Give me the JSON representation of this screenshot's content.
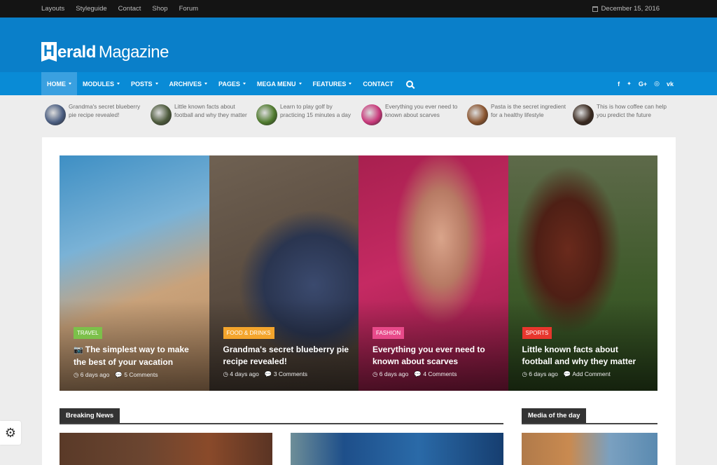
{
  "topbar": {
    "links": [
      "Layouts",
      "Styleguide",
      "Contact",
      "Shop",
      "Forum"
    ],
    "date_icon": "calendar-icon",
    "date": "December 15, 2016"
  },
  "logo": {
    "letter": "H",
    "bold": "erald",
    "light": "Magazine"
  },
  "nav": {
    "items": [
      {
        "label": "HOME",
        "caret": true,
        "active": true
      },
      {
        "label": "MODULES",
        "caret": true
      },
      {
        "label": "POSTS",
        "caret": true
      },
      {
        "label": "ARCHIVES",
        "caret": true
      },
      {
        "label": "PAGES",
        "caret": true
      },
      {
        "label": "MEGA MENU",
        "caret": true
      },
      {
        "label": "FEATURES",
        "caret": true
      },
      {
        "label": "CONTACT",
        "caret": false
      }
    ],
    "search_icon": "search-icon",
    "social": [
      "f",
      "🐦",
      "G+",
      "◎",
      "vk"
    ]
  },
  "ticker": [
    {
      "text": "Grandma's secret blueberry pie recipe revealed!",
      "color": "#4a5d80"
    },
    {
      "text": "Little known facts about football and why they matter",
      "color": "#4d5a3c"
    },
    {
      "text": "Learn to play golf by practicing 15 minutes a day",
      "color": "#4f7a2e"
    },
    {
      "text": "Everything you ever need to known about scarves",
      "color": "#c8387a"
    },
    {
      "text": "Pasta is the secret ingredient for a healthy lifestyle",
      "color": "#8a5530"
    },
    {
      "text": "This is how coffee can help you predict the future",
      "color": "#3a2a20"
    }
  ],
  "hero": [
    {
      "category": "TRAVEL",
      "badge_color": "#7cc04a",
      "title": "The simplest way to make the best of your vacation",
      "camera": true,
      "time": "6 days ago",
      "comments": "5 Comments",
      "bg": "linear-gradient(160deg,#3e8fc4 0%,#7ab2d6 35%,#c9a27a 60%,#b58a62 100%)"
    },
    {
      "category": "FOOD & DRINKS",
      "badge_color": "#f4a52c",
      "title": "Grandma's secret blueberry pie recipe revealed!",
      "camera": false,
      "time": "4 days ago",
      "comments": "3 Comments",
      "bg": "radial-gradient(circle at 70% 55%,#3b4a6e 0%,#2a3550 30%,transparent 45%),linear-gradient(160deg,#6f6152 0%,#5a4c40 50%,#4a3e34 100%)"
    },
    {
      "category": "FASHION",
      "badge_color": "#e84a8a",
      "title": "Everything you ever need to known about scarves",
      "camera": false,
      "time": "6 days ago",
      "comments": "4 Comments",
      "bg": "radial-gradient(ellipse at 55% 35%,#d9a48a 0%,#b77a64 22%,transparent 40%),linear-gradient(160deg,#a8204f 0%,#c52a63 45%,#8f1c44 100%)"
    },
    {
      "category": "SPORTS",
      "badge_color": "#e8362d",
      "title": "Little known facts about football and why they matter",
      "camera": false,
      "time": "6 days ago",
      "comments": "Add Comment",
      "bg": "radial-gradient(ellipse at 40% 40%,#6a2a1c 0%,#4e1f15 25%,transparent 42%),linear-gradient(180deg,#5e6a4a 0%,#3e5a2a 55%,#2d4a1e 100%)"
    }
  ],
  "sections": {
    "breaking": "Breaking News",
    "media": "Media of the day"
  },
  "settings_icon": "gear-icon"
}
